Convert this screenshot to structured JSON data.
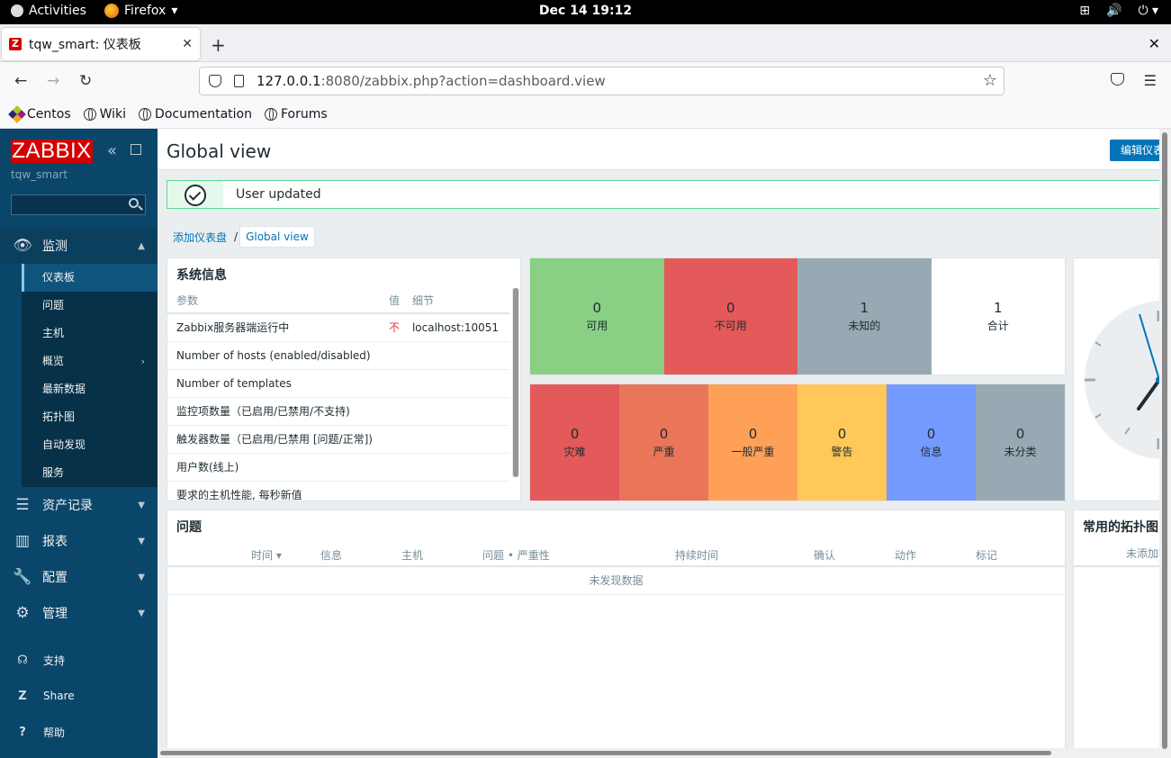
{
  "gnome": {
    "activities": "Activities",
    "app_name": "Firefox",
    "clock": "Dec 14  19:12"
  },
  "browser": {
    "tab_title": "tqw_smart: 仪表板",
    "tab_favicon": "Z",
    "url_host": "127.0.0.1",
    "url_rest": ":8080/zabbix.php?action=dashboard.view",
    "bookmarks": [
      "Centos",
      "Wiki",
      "Documentation",
      "Forums"
    ]
  },
  "sidebar": {
    "logo": "ZABBIX",
    "server_name": "tqw_smart",
    "search_placeholder": "",
    "menu": [
      {
        "label": "监测",
        "icon": "eye-icon",
        "expanded": true
      },
      {
        "label": "资产记录",
        "icon": "list-icon"
      },
      {
        "label": "报表",
        "icon": "bar-chart-icon"
      },
      {
        "label": "配置",
        "icon": "wrench-icon"
      },
      {
        "label": "管理",
        "icon": "gear-icon"
      }
    ],
    "monitoring_items": [
      "仪表板",
      "问题",
      "主机",
      "概览",
      "最新数据",
      "拓扑图",
      "自动发现",
      "服务"
    ],
    "bottom": [
      {
        "label": "支持",
        "icon": "headset-icon"
      },
      {
        "label": "Share",
        "icon": "share-icon"
      },
      {
        "label": "帮助",
        "icon": "help-icon"
      }
    ]
  },
  "main": {
    "title": "Global view",
    "edit_button": "编辑仪表盘",
    "message": "User updated",
    "breadcrumb": {
      "parent": "添加仪表盘",
      "separator": "/",
      "current": "Global view"
    }
  },
  "system_info": {
    "title": "系统信息",
    "headers": {
      "param": "参数",
      "value": "值",
      "details": "细节"
    },
    "rows": [
      {
        "param": "Zabbix服务器端运行中",
        "value": "不",
        "details": "localhost:10051"
      },
      {
        "param": "Number of hosts (enabled/disabled)",
        "value": "",
        "details": ""
      },
      {
        "param": "Number of templates",
        "value": "",
        "details": ""
      },
      {
        "param": "监控项数量（已启用/已禁用/不支持)",
        "value": "",
        "details": ""
      },
      {
        "param": "触发器数量（已启用/已禁用 [问题/正常])",
        "value": "",
        "details": ""
      },
      {
        "param": "用户数(线上)",
        "value": "",
        "details": ""
      },
      {
        "param": "要求的主机性能, 每秒新值",
        "value": "",
        "details": ""
      }
    ]
  },
  "host_availability": [
    {
      "value": "0",
      "label": "可用",
      "color": "#89cf84"
    },
    {
      "value": "0",
      "label": "不可用",
      "color": "#e45959"
    },
    {
      "value": "1",
      "label": "未知的",
      "color": "#97aab3"
    },
    {
      "value": "1",
      "label": "合计",
      "color": "#ffffff"
    }
  ],
  "severity": [
    {
      "value": "0",
      "label": "灾难",
      "color": "#e45959"
    },
    {
      "value": "0",
      "label": "严重",
      "color": "#e97659"
    },
    {
      "value": "0",
      "label": "一般严重",
      "color": "#ffa059"
    },
    {
      "value": "0",
      "label": "警告",
      "color": "#ffc859"
    },
    {
      "value": "0",
      "label": "信息",
      "color": "#7499ff"
    },
    {
      "value": "0",
      "label": "未分类",
      "color": "#97aab3"
    }
  ],
  "problems": {
    "title": "问题",
    "headers": [
      "时间 ▾",
      "信息",
      "主机",
      "问题 • 严重性",
      "持续时间",
      "确认",
      "动作",
      "标记"
    ],
    "empty": "未发现数据"
  },
  "fav_maps": {
    "title": "常用的拓扑图",
    "empty": "未添加拓扑图"
  }
}
